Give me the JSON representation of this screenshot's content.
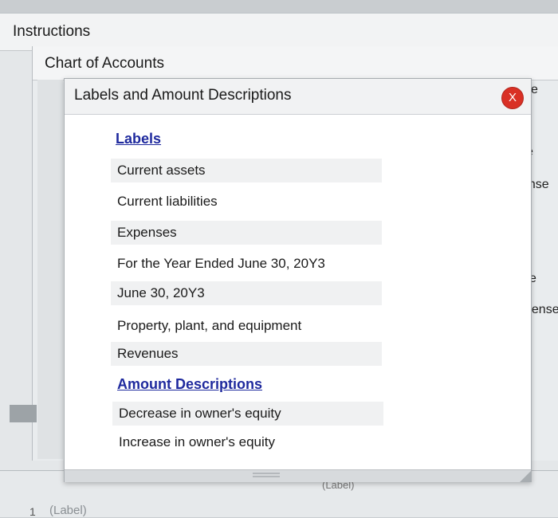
{
  "instructions": {
    "title": "Instructions"
  },
  "chart_of_accounts": {
    "title": "Chart of Accounts"
  },
  "background_fragments": [
    "e",
    "e",
    "ense",
    "se",
    "xpense"
  ],
  "modal": {
    "title": "Labels and Amount Descriptions",
    "close_label": "X",
    "labels_heading": "Labels",
    "labels": [
      "Current assets",
      "Current liabilities",
      "Expenses",
      "For the Year Ended June 30, 20Y3",
      "June 30, 20Y3",
      "Property, plant, and equipment",
      "Revenues"
    ],
    "amount_heading": "Amount Descriptions",
    "amount_descriptions": [
      "Decrease in owner's equity",
      "Increase in owner's equity"
    ]
  },
  "table": {
    "row_number": "1",
    "row_label": "(Label)",
    "column_fragment": "(Label)"
  },
  "colors": {
    "close_button": "#d93025",
    "link_heading": "#1f2a9e"
  }
}
